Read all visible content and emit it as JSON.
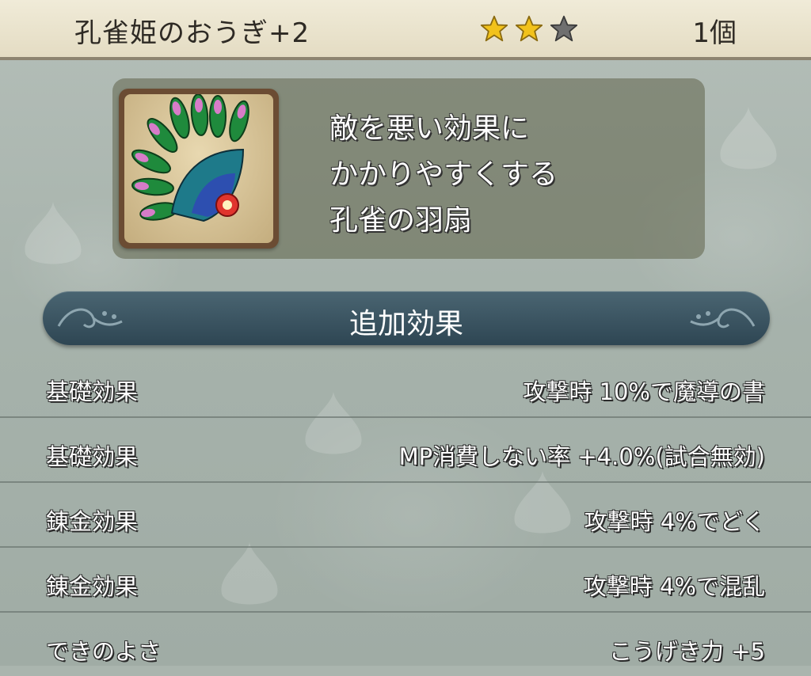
{
  "header": {
    "item_name": "孔雀姫のおうぎ+2",
    "rating": 2,
    "max_rating": 3,
    "count": "1個"
  },
  "item": {
    "icon": "peacock-fan-icon",
    "description": [
      "敵を悪い効果に",
      "かかりやすくする",
      "孔雀の羽扇"
    ]
  },
  "effects": {
    "title": "追加効果",
    "rows": [
      {
        "label": "基礎効果",
        "value": "攻撃時 10%で魔導の書"
      },
      {
        "label": "基礎効果",
        "value": "MP消費しない率 +4.0%(試合無効)"
      },
      {
        "label": "錬金効果",
        "value": "攻撃時 4%でどく"
      },
      {
        "label": "錬金効果",
        "value": "攻撃時 4%で混乱"
      },
      {
        "label": "できのよさ",
        "value": "こうげき力 +5"
      }
    ]
  },
  "colors": {
    "star_filled": "#f2c21b",
    "star_empty": "#6f6f6f",
    "banner": "#2e4653"
  }
}
